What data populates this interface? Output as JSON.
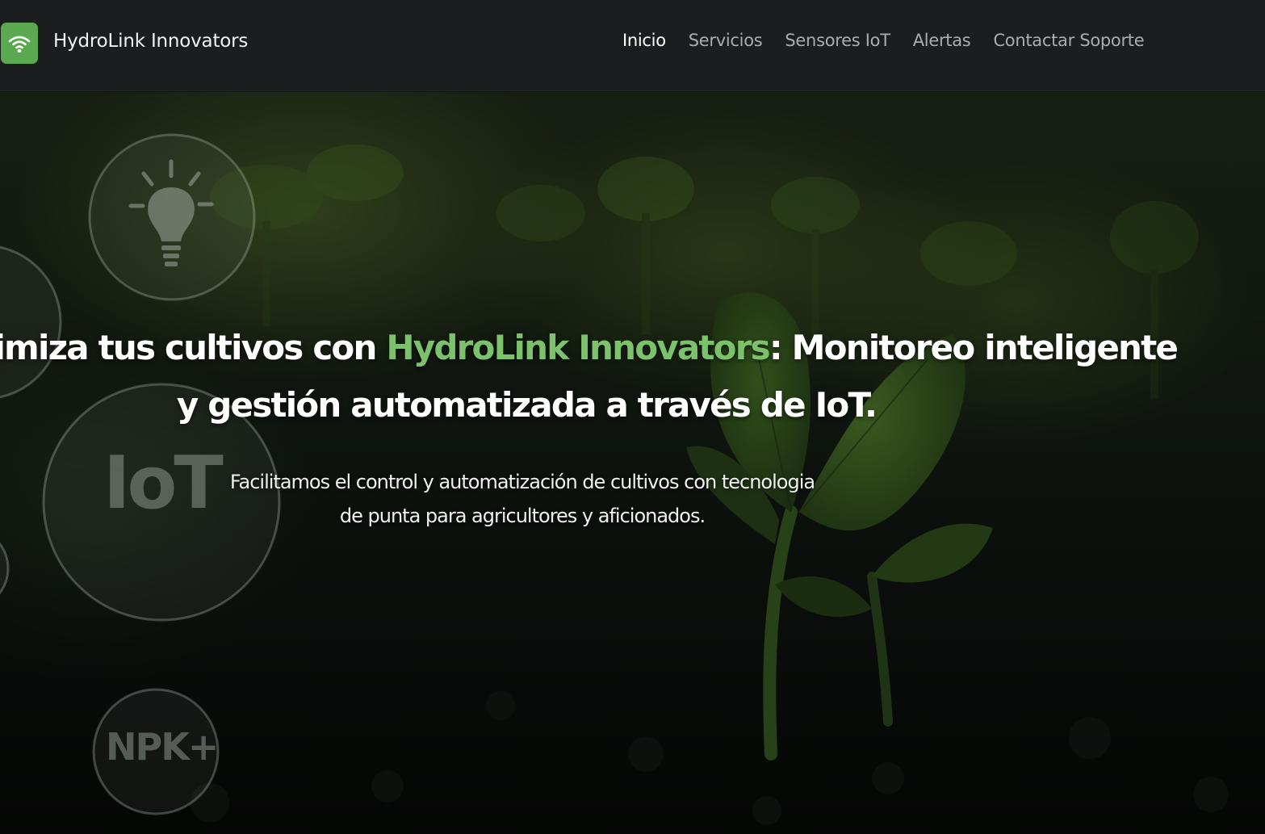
{
  "header": {
    "brand_name": "HydroLink Innovators",
    "logo_icon": "wifi-icon",
    "nav": [
      {
        "label": "Inicio",
        "active": true
      },
      {
        "label": "Servicios",
        "active": false
      },
      {
        "label": "Sensores IoT",
        "active": false
      },
      {
        "label": "Alertas",
        "active": false
      },
      {
        "label": "Contactar Soporte",
        "active": false
      }
    ]
  },
  "hero": {
    "title_prefix": "ptimiza tus cultivos con ",
    "title_accent": "HydroLink Innovators",
    "title_suffix": ": Monitoreo inteligente",
    "title_line2": "y gestión automatizada a través de IoT.",
    "subtitle_line1": "Facilitamos el control y automatización de cultivos con tecnologia",
    "subtitle_line2": "de punta para agricultores y aficionados.",
    "badges": [
      {
        "icon": "lightbulb-icon"
      },
      {
        "label": "IoT"
      },
      {
        "label": "NPK+"
      }
    ]
  },
  "colors": {
    "navbar_bg": "#1b1d1f",
    "logo_bg": "#5aa84f",
    "accent_green": "#7cc16b",
    "nav_active": "#ffffff",
    "nav_inactive": "#a9adb1"
  }
}
